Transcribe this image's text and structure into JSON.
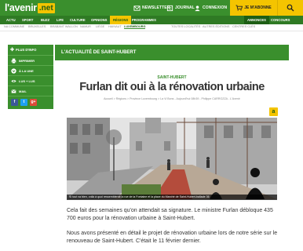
{
  "header": {
    "logo_text": "l'avenir",
    "logo_suffix": ".net",
    "newsletter": "NEWSLETTER",
    "journal": "JOURNAL",
    "connexion": "CONNEXION",
    "abonner": "JE M'ABONNE"
  },
  "nav_main": [
    "ACTU",
    "SPORT",
    "BUZZ",
    "LIFE",
    "CULTURE",
    "OPINIONS",
    "RÉGIONS",
    "PROGRAMMES"
  ],
  "nav_main_right": [
    "ANNONCES",
    "CONCOURS"
  ],
  "nav_sub": [
    "NA COMMUNE",
    "BRUXELLES",
    "BRABANT WALLON",
    "NAMUR",
    "LIÈGE",
    "HAINAUT",
    "LUXEMBOURG",
    "TOUTES LOCALITÉS",
    "AUTRES ÉDITIONS",
    "CENTRES CLÉS"
  ],
  "sidebar": {
    "head": "PLUS D'INFO",
    "items": [
      "IMPRIMER",
      "À LA UNE",
      "LUS + LUS",
      "MAIL"
    ],
    "social": [
      "f",
      "t",
      "g+"
    ]
  },
  "section_title": "L'ACTUALITÉ DE SAINT-HUBERT",
  "article": {
    "kicker": "SAINT-HUBERT",
    "title": "Furlan dit oui à la rénovation urbaine",
    "breadcrumb": "Accueil > Régions > Province Luxembourg > La Vi Bons - Aujourd'hui 08h39 - Philippe CARROZZA - L'Avenir",
    "badge": "a",
    "caption": "Si tout va bien, voilà à quoi ressemblerait la rue de la Fontaine et la place du Marché de Saint-Hubert-ballade 36",
    "p1": "Cela fait des semaines qu'on attendait sa signature. Le ministre Furlan débloque 435 700 euros pour la rénovation urbaine à Saint-Hubert.",
    "p2": "Nous avons présenté en détail le projet de rénovation urbaine lors de notre série sur le renouveau de Saint-Hubert. C'était le 11 février dernier."
  }
}
